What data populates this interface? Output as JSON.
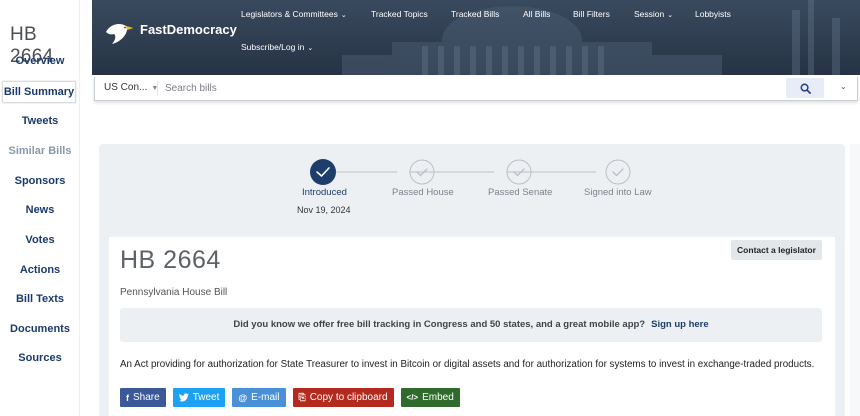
{
  "sidebar": {
    "title": "HB 2664",
    "items": [
      {
        "label": "Overview",
        "state": "normal"
      },
      {
        "label": "Bill Summary",
        "state": "active"
      },
      {
        "label": "Tweets",
        "state": "normal"
      },
      {
        "label": "Similar Bills",
        "state": "muted"
      },
      {
        "label": "Sponsors",
        "state": "normal"
      },
      {
        "label": "News",
        "state": "normal"
      },
      {
        "label": "Votes",
        "state": "normal"
      },
      {
        "label": "Actions",
        "state": "normal"
      },
      {
        "label": "Bill Texts",
        "state": "normal"
      },
      {
        "label": "Documents",
        "state": "normal"
      },
      {
        "label": "Sources",
        "state": "normal"
      }
    ]
  },
  "header": {
    "brand": "FastDemocracy",
    "nav": [
      {
        "label": "Legislators & Committees",
        "dropdown": true
      },
      {
        "label": "Tracked Topics",
        "dropdown": false
      },
      {
        "label": "Tracked Bills",
        "dropdown": false
      },
      {
        "label": "All Bills",
        "dropdown": false
      },
      {
        "label": "Bill Filters",
        "dropdown": false
      },
      {
        "label": "Session",
        "dropdown": true
      },
      {
        "label": "Lobbyists",
        "dropdown": false
      }
    ],
    "subscribe": "Subscribe/Log in",
    "colors": {
      "background": "#2b3a4c",
      "logo_yellow": "#f2b51c"
    }
  },
  "search": {
    "scope": "US Con...",
    "placeholder": "Search bills",
    "value": "",
    "icon": "search-icon",
    "expand_icon": "chevron-down-icon"
  },
  "progress": {
    "steps": [
      {
        "label": "Introduced",
        "complete": true
      },
      {
        "label": "Passed House",
        "complete": false
      },
      {
        "label": "Passed Senate",
        "complete": false
      },
      {
        "label": "Signed into Law",
        "complete": false
      }
    ],
    "date": "Nov 19, 2024",
    "active_color": "#1d3d6a"
  },
  "bill": {
    "title": "HB 2664",
    "type": "Pennsylvania House Bill",
    "contact": "Contact a legislator",
    "promo_text": "Did you know we offer free bill tracking in Congress and 50 states, and a great mobile app?",
    "promo_link": "Sign up here",
    "description": "An Act providing for authorization for State Treasurer to invest in Bitcoin or digital assets and for authorization for systems to invest in exchange-traded products."
  },
  "share": {
    "buttons": [
      {
        "label": "Share",
        "icon": "f",
        "icon_name": "facebook-icon",
        "color": "#3b5998"
      },
      {
        "label": "Tweet",
        "icon": "✔",
        "icon_name": "twitter-icon",
        "color": "#1da1f2"
      },
      {
        "label": "E-mail",
        "icon": "@",
        "icon_name": "email-icon",
        "color": "#4a90d9"
      },
      {
        "label": "Copy to clipboard",
        "icon": "⎘",
        "icon_name": "clipboard-icon",
        "color": "#b52a1e"
      },
      {
        "label": "Embed",
        "icon": "</>",
        "icon_name": "code-icon",
        "color": "#2f6b2c"
      }
    ]
  }
}
